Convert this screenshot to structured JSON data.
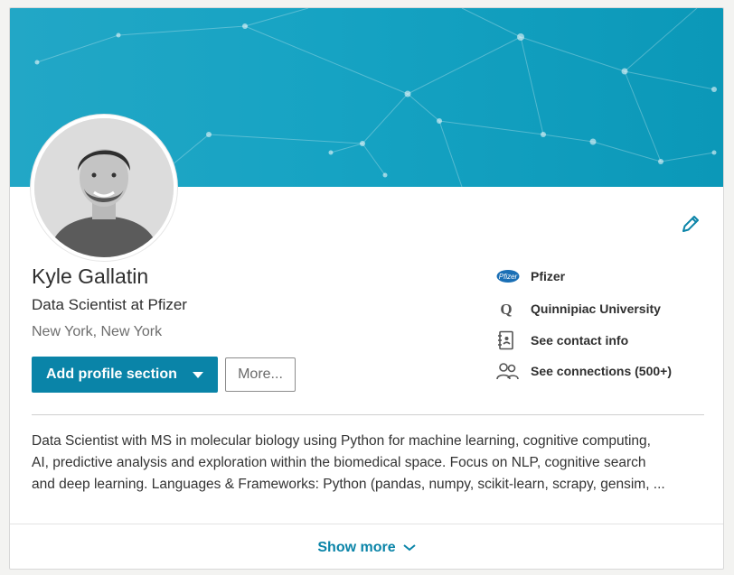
{
  "profile": {
    "name": "Kyle Gallatin",
    "headline": "Data Scientist at Pfizer",
    "location": "New York, New York"
  },
  "actions": {
    "add_section_label": "Add profile section",
    "more_label": "More..."
  },
  "sidebar": {
    "items": [
      {
        "label": "Pfizer",
        "icon": "pfizer-logo-icon"
      },
      {
        "label": "Quinnipiac University",
        "icon": "quinnipiac-logo-icon"
      },
      {
        "label": "See contact info",
        "icon": "contact-card-icon"
      },
      {
        "label": "See connections (500+)",
        "icon": "people-icon"
      }
    ]
  },
  "summary": {
    "lines": [
      "Data Scientist with MS in molecular biology using Python for machine learning, cognitive computing,",
      "AI, predictive analysis and exploration within the biomedical space. Focus on NLP, cognitive search",
      "and deep learning. Languages & Frameworks: Python (pandas, numpy, scikit-learn, scrapy, gensim, ..."
    ]
  },
  "footer": {
    "show_more_label": "Show more"
  },
  "colors": {
    "accent": "#0a84a8",
    "banner": "#16a3c3"
  }
}
